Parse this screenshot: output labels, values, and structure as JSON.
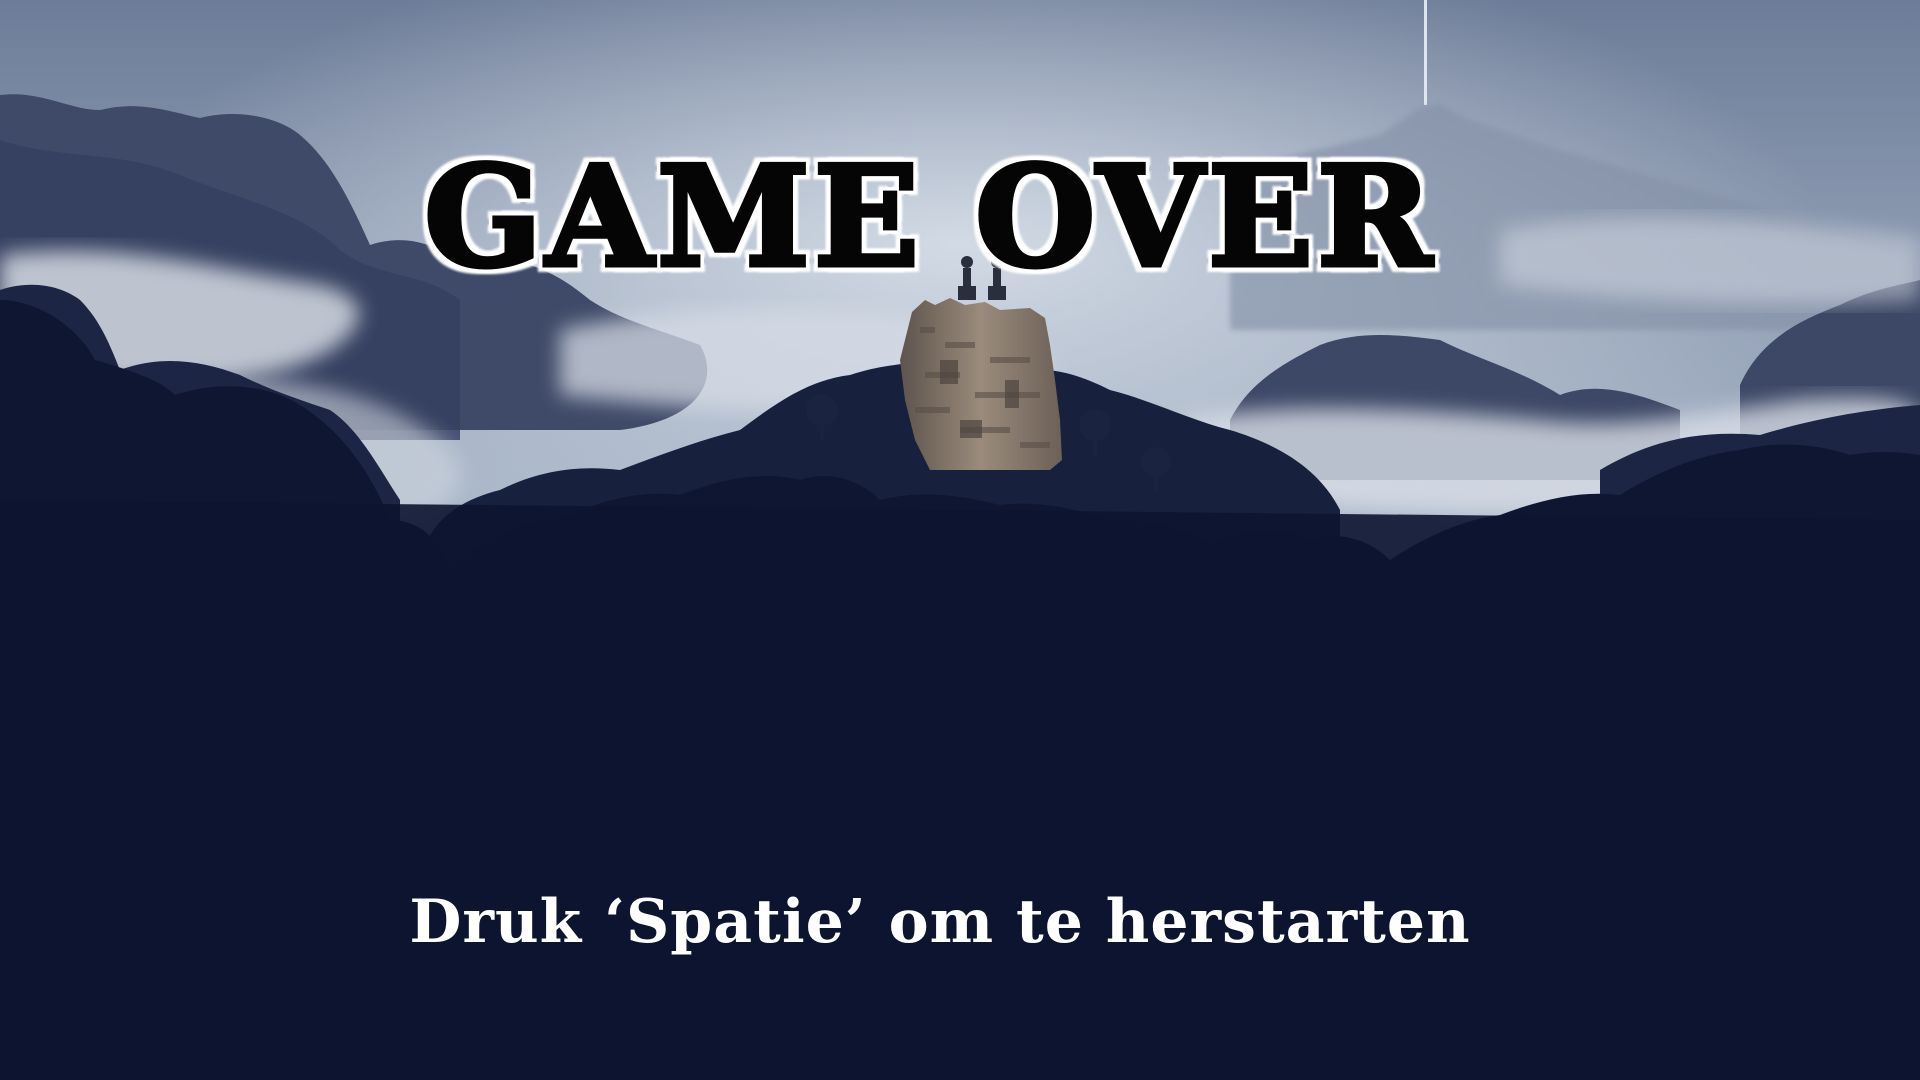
{
  "screen": {
    "title": "GAME OVER",
    "restart_hint": "Druk ‘Spatie’ om te herstarten"
  },
  "colors": {
    "sky_top": "#6f7f9c",
    "sky_glow": "#b9c6d6",
    "fog": "#cdd3de",
    "far_hills": "#4a5672",
    "mid_hills": "#2a3554",
    "foreground": "#0d1530",
    "tower": "#8e7f70",
    "title_fill": "#050505",
    "title_outline": "#ffffff",
    "hint_text": "#ffffff"
  },
  "icons": {
    "tower": "ruined-tower-icon",
    "figures": "character-silhouettes-icon"
  }
}
